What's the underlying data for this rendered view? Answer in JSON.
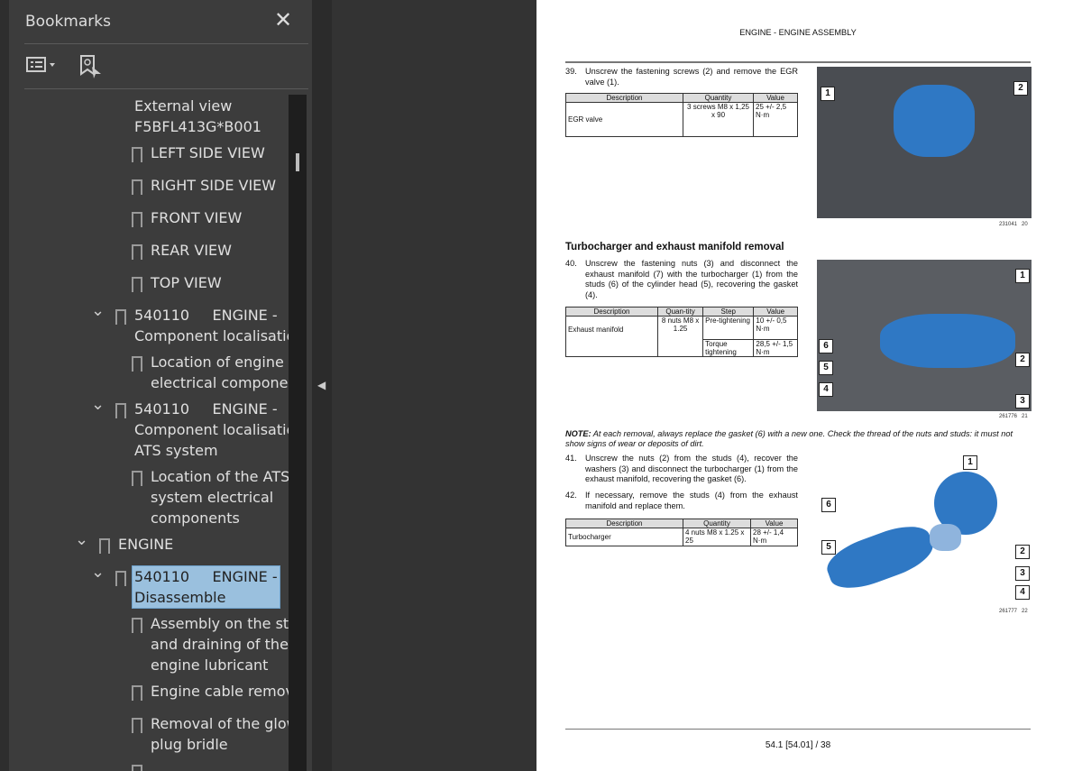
{
  "sidebar": {
    "title": "Bookmarks",
    "close_icon": "close-icon",
    "options_icon": "list-options-icon",
    "add_bookmark_icon": "bookmark-add-icon",
    "items": [
      {
        "level": 2,
        "chev": false,
        "icon": false,
        "lines": [
          "External view",
          "F5BFL413G*B001"
        ]
      },
      {
        "level": 3,
        "chev": false,
        "icon": true,
        "lines": [
          "LEFT SIDE VIEW"
        ]
      },
      {
        "level": 3,
        "chev": false,
        "icon": true,
        "lines": [
          "RIGHT SIDE VIEW"
        ]
      },
      {
        "level": 3,
        "chev": false,
        "icon": true,
        "lines": [
          "FRONT VIEW"
        ]
      },
      {
        "level": 3,
        "chev": false,
        "icon": true,
        "lines": [
          "REAR VIEW"
        ]
      },
      {
        "level": 3,
        "chev": false,
        "icon": true,
        "lines": [
          "TOP VIEW"
        ]
      },
      {
        "level": 2,
        "chev": true,
        "icon": true,
        "lines": [
          "540110     ENGINE -",
          "Component localisation"
        ]
      },
      {
        "level": 3,
        "chev": false,
        "icon": true,
        "lines": [
          "Location of engine",
          "electrical components"
        ]
      },
      {
        "level": 2,
        "chev": true,
        "icon": true,
        "lines": [
          "540110     ENGINE -",
          "Component localisation -",
          "ATS system"
        ]
      },
      {
        "level": 3,
        "chev": false,
        "icon": true,
        "lines": [
          "Location of the ATS",
          "system electrical",
          "components"
        ]
      },
      {
        "level": 1,
        "chev": true,
        "icon": true,
        "lines": [
          "ENGINE"
        ]
      },
      {
        "level": 2,
        "chev": true,
        "icon": true,
        "selected": true,
        "lines": [
          "540110     ENGINE -",
          "Disassemble"
        ]
      },
      {
        "level": 3,
        "chev": false,
        "icon": true,
        "lines": [
          "Assembly on the stand",
          "and draining of the",
          "engine lubricant"
        ]
      },
      {
        "level": 3,
        "chev": false,
        "icon": true,
        "lines": [
          "Engine cable removal"
        ]
      },
      {
        "level": 3,
        "chev": false,
        "icon": true,
        "lines": [
          "Removal of the glow",
          "plug bridle"
        ]
      },
      {
        "level": 3,
        "chev": false,
        "icon": true,
        "lines": [
          ""
        ]
      }
    ]
  },
  "page": {
    "header": "ENGINE - ENGINE ASSEMBLY",
    "step39": {
      "num": "39.",
      "text": "Unscrew the fastening screws (2) and remove the EGR valve (1).",
      "table": {
        "headers": [
          "Description",
          "Quantity",
          "Value"
        ],
        "row": [
          "EGR valve",
          "3 screws M8 x 1,25 x 90",
          "25 +/- 2,5 N·m"
        ]
      }
    },
    "fig20": {
      "code": "231041",
      "num": "20",
      "callouts": [
        "1",
        "2"
      ]
    },
    "section_title": "Turbocharger and exhaust manifold removal",
    "step40": {
      "num": "40.",
      "text": "Unscrew the fastening nuts (3) and disconnect the exhaust manifold (7) with the turbocharger (1) from the studs (6) of the cylinder head (5), recovering the gasket (4).",
      "table": {
        "headers": [
          "Description",
          "Quan-tity",
          "Step",
          "Value"
        ],
        "desc": "Exhaust manifold",
        "qty": "8 nuts M8 x 1.25",
        "steps": [
          [
            "Pre-tightening",
            "10 +/- 0,5 N·m"
          ],
          [
            "Torque tightening",
            "28,5 +/- 1,5 N·m"
          ]
        ]
      }
    },
    "fig21": {
      "code": "261776",
      "num": "21",
      "callouts": [
        "1",
        "2",
        "3",
        "4",
        "5",
        "6"
      ]
    },
    "note": {
      "label": "NOTE:",
      "text": " At each removal, always replace the gasket (6) with a new one.  Check the thread of the nuts and studs: it must not show signs of wear or deposits of dirt."
    },
    "step41": {
      "num": "41.",
      "text": "Unscrew the nuts (2) from the studs (4), recover the washers (3) and disconnect the turbocharger (1) from the exhaust manifold, recovering the gasket (6)."
    },
    "step42": {
      "num": "42.",
      "text": "If necessary, remove the studs (4) from the exhaust manifold and replace them.",
      "table": {
        "headers": [
          "Description",
          "Quantity",
          "Value"
        ],
        "row": [
          "Turbocharger",
          "4 nuts M8 x 1.25 x 25",
          "28 +/- 1,4 N·m"
        ]
      }
    },
    "fig22": {
      "code": "261777",
      "num": "22",
      "callouts": [
        "1",
        "6",
        "5",
        "2",
        "3",
        "4"
      ]
    },
    "footer": "54.1 [54.01] / 38"
  },
  "colors": {
    "panel": "#3c3c3c",
    "selection": "#9ac0de",
    "part_highlight": "#2f78c4"
  }
}
